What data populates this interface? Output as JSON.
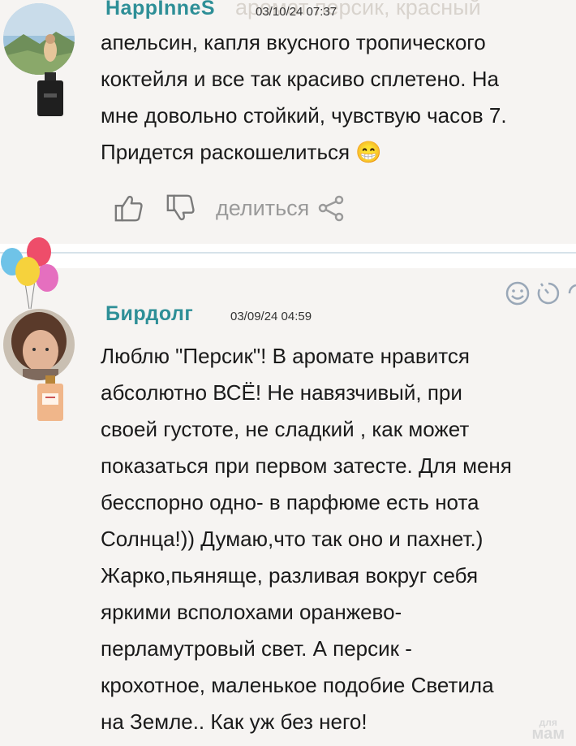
{
  "comments": [
    {
      "username": "HappInneS",
      "timestamp": "03/10/24 07:37",
      "ghost_text": "аромат   персик, красный",
      "lines": [
        "апельсин, капля вкусного тропического",
        "коктейля и все так красиво сплетено. На",
        "мне довольно стойкий, чувствую часов 7.",
        "Придется раскошелиться 😁"
      ],
      "share_label": "делиться"
    },
    {
      "username": "Бирдолг",
      "timestamp": "03/09/24 04:59",
      "lines": [
        "Люблю \"Персик\"! В аромате нравится",
        "абсолютно ВСЁ! Не навязчивый, при",
        "своей густоте, не сладкий , как может",
        "показаться при первом затесте. Для меня",
        "бесспорно одно- в парфюме есть нота",
        "Солнца!)) Думаю,что так оно и пахнет.)",
        "Жарко,пьянящe, разливая вокруг себя",
        "яркими всполохами оранжево-",
        "перламутровый свет. А персик -",
        "крохотное, маленькое подобие Светила",
        "на Земле.. Как уж без него!"
      ]
    }
  ],
  "watermark": {
    "small": "для",
    "big": "мам"
  },
  "colors": {
    "username": "#2e8f97",
    "background": "#f6f4f2",
    "divider": "#d6e2ea"
  },
  "icons": [
    "like-icon",
    "dislike-icon",
    "share-icon",
    "smiley-icon",
    "timer-icon",
    "balloons-icon"
  ]
}
